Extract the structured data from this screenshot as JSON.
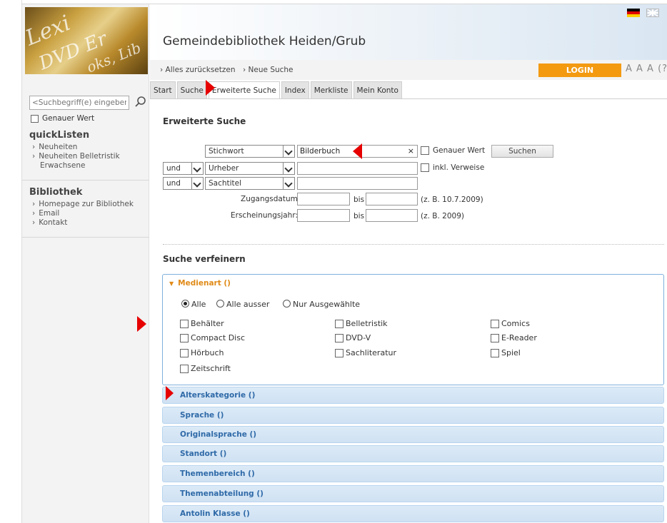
{
  "sidebar": {
    "search_placeholder": "<Suchbegriff(e) eingeben>",
    "exact_label": "Genauer Wert",
    "quicklists_title": "quickListen",
    "quicklists": [
      "Neuheiten",
      "Neuheiten Belletristik",
      "Erwachsene"
    ],
    "library_title": "Bibliothek",
    "library_links": [
      "Homepage zur Bibliothek",
      "Email",
      "Kontakt"
    ]
  },
  "header": {
    "title": "Gemeindebibliothek Heiden/Grub",
    "reset_label": "Alles zurücksetzen",
    "new_search_label": "Neue Suche",
    "login_label": "LOGIN",
    "font_sizes": "A A A (?"
  },
  "tabs": [
    "Start",
    "Suche",
    "Erweiterte Suche",
    "Index",
    "Merkliste",
    "Mein Konto"
  ],
  "advanced": {
    "heading": "Erweiterte Suche",
    "rows": [
      {
        "operator": "",
        "field": "Stichwort",
        "value": "Bilderbuch"
      },
      {
        "operator": "und",
        "field": "Urheber",
        "value": ""
      },
      {
        "operator": "und",
        "field": "Sachtitel",
        "value": ""
      }
    ],
    "clear_glyph": "×",
    "exact_label": "Genauer Wert",
    "search_button": "Suchen",
    "references_label": "inkl. Verweise",
    "date_label": "Zugangsdatum:",
    "year_label": "Erscheinungsjahr:",
    "bis": "bis",
    "date_hint": "(z. B. 10.7.2009)",
    "year_hint": "(z. B. 2009)"
  },
  "refine": {
    "heading": "Suche verfeinern",
    "open_section": "Medienart ()",
    "radios": [
      "Alle",
      "Alle ausser",
      "Nur Ausgewählte"
    ],
    "media_types": [
      "Behälter",
      "Belletristik",
      "Comics",
      "Compact Disc",
      "DVD-V",
      "E-Reader",
      "Hörbuch",
      "Sachliteratur",
      "Spiel",
      "Zeitschrift"
    ],
    "sections": [
      "Alterskategorie ()",
      "Sprache ()",
      "Originalsprache ()",
      "Standort ()",
      "Themenbereich ()",
      "Themenabteilung ()",
      "Antolin Klasse ()"
    ]
  },
  "colors": {
    "accent_orange": "#f39a11",
    "section_blue": "#2f6aa8",
    "marker_red": "#e60000"
  }
}
